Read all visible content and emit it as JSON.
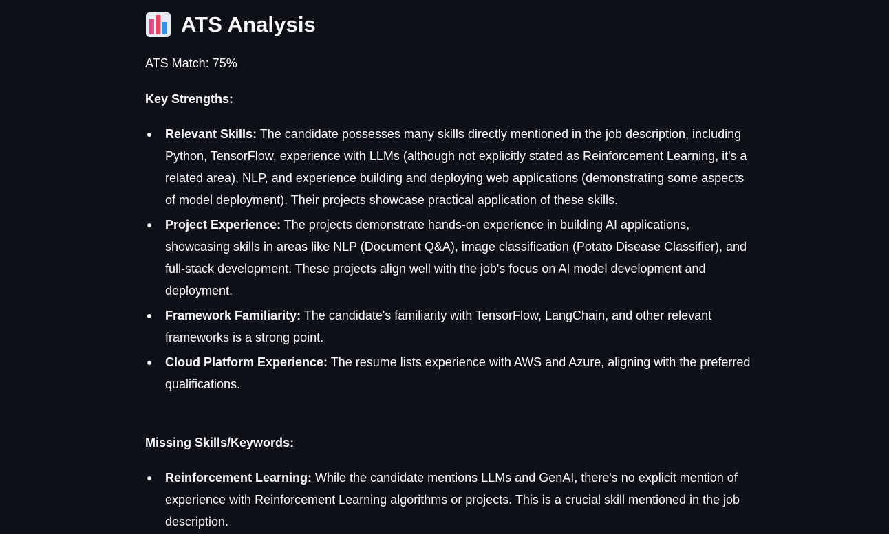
{
  "header": {
    "icon": "bar-chart-icon",
    "title": "ATS Analysis"
  },
  "match": {
    "text": "ATS Match: 75%"
  },
  "strengths": {
    "heading": "Key Strengths:",
    "items": [
      {
        "term": "Relevant Skills:",
        "text": " The candidate possesses many skills directly mentioned in the job description, including Python, TensorFlow, experience with LLMs (although not explicitly stated as Reinforcement Learning, it's a related area), NLP, and experience building and deploying web applications (demonstrating some aspects of model deployment). Their projects showcase practical application of these skills."
      },
      {
        "term": "Project Experience:",
        "text": " The projects demonstrate hands-on experience in building AI applications, showcasing skills in areas like NLP (Document Q&A), image classification (Potato Disease Classifier), and full-stack development. These projects align well with the job's focus on AI model development and deployment."
      },
      {
        "term": "Framework Familiarity:",
        "text": " The candidate's familiarity with TensorFlow, LangChain, and other relevant frameworks is a strong point."
      },
      {
        "term": "Cloud Platform Experience:",
        "text": " The resume lists experience with AWS and Azure, aligning with the preferred qualifications."
      }
    ]
  },
  "missing": {
    "heading": "Missing Skills/Keywords:",
    "items": [
      {
        "term": "Reinforcement Learning:",
        "text": " While the candidate mentions LLMs and GenAI, there's no explicit mention of experience with Reinforcement Learning algorithms or projects. This is a crucial skill mentioned in the job description."
      }
    ]
  },
  "colors": {
    "background": "#0e1117",
    "text": "#fafafa"
  }
}
